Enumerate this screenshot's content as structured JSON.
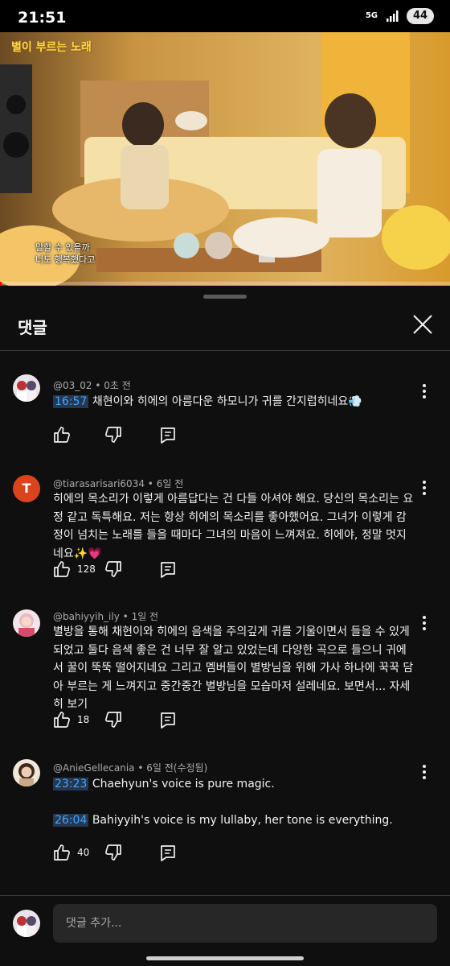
{
  "status_bar": {
    "time": "21:51",
    "network_label": "5G",
    "battery_level": "44"
  },
  "video": {
    "show_logo": "별이 부르는 노래",
    "subtitle_line1": "말할 수 있을까",
    "subtitle_line2": "너도 행복했다고",
    "progress_fraction": 0.0
  },
  "comments_panel": {
    "title": "댓글",
    "close_icon": "close-icon"
  },
  "comments": [
    {
      "author": "@03_02",
      "time": "0초 전",
      "timestamps": [
        "16:57"
      ],
      "text_parts": [
        "채현이와 히에의 아름다운 하모니가 귀를 간지럽히네요💨"
      ],
      "likes": "",
      "avatar": "photo"
    },
    {
      "author": "@tiarasarisari6034",
      "time": "6일 전",
      "text": "히에의 목소리가 이렇게 아름답다는 건 다들 아셔야 해요. 당신의 목소리는 요정 같고 독특해요. 저는 항상 히에의 목소리를 좋아했어요. 그녀가 이렇게 감정이 넘치는 노래를 들을 때마다 그녀의 마음이 느껴져요. 히에야, 정말 멋지네요✨💗",
      "likes": "128",
      "avatar_letter": "T",
      "avatar_color": "#d9441d"
    },
    {
      "author": "@bahiyyih_ily",
      "time": "1일 전",
      "text": "별방을 통해 채현이와 히에의 음색을 주의깊게 귀를 기울이면서 들을 수 있게 되었고 둘다 음색 좋은 건 너무 잘 알고 있었는데 다양한 곡으로 들으니 귀에서 꿀이 뚝뚝 떨어지네요 그리고 멤버들이 별방님을 위해 가사 하나에 꾹꾹 담아 부르는 게 느껴지고 중간중간 별방님을 모습마저 설레네요. 보면서...",
      "more_label": "자세히 보기",
      "likes": "18",
      "avatar": "photo"
    },
    {
      "author": "@AnieGellecania",
      "time": "6일 전(수정됨)",
      "line1_timestamp": "23:23",
      "line1_text": "Chaehyun's voice is pure magic.",
      "line2_timestamp": "26:04",
      "line2_text": "Bahiyyih's voice is my lullaby, her tone is everything.",
      "likes": "40",
      "avatar": "photo"
    }
  ],
  "composer": {
    "placeholder": "댓글 추가..."
  },
  "colors": {
    "background": "#0f0f0f",
    "timestamp_link": "#3ea6ff",
    "timestamp_bg": "#263850",
    "progress_red": "#ff0000",
    "avatar_t": "#d9441d"
  }
}
